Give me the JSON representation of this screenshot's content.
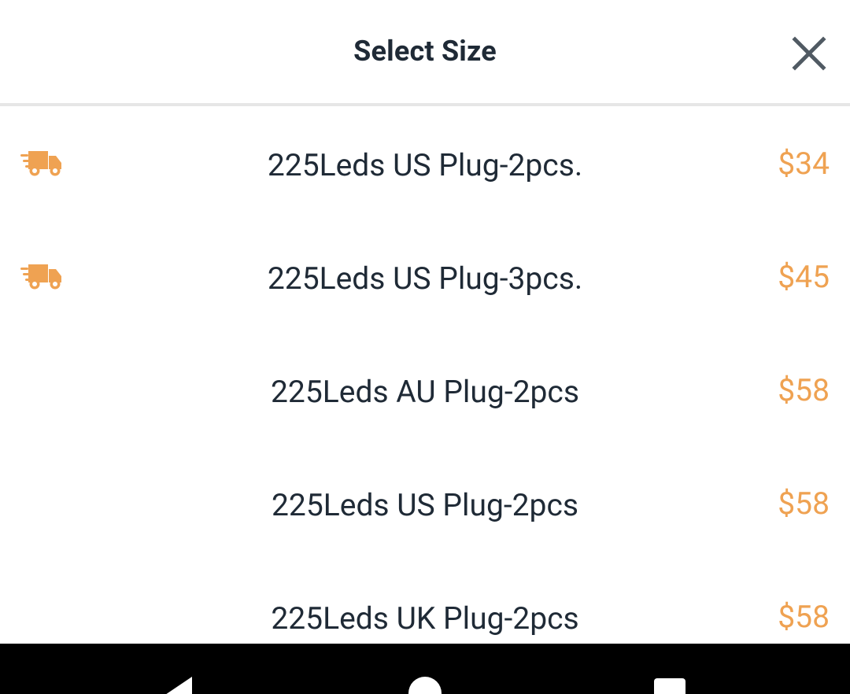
{
  "header": {
    "title": "Select Size",
    "close_icon": "close-icon"
  },
  "options": [
    {
      "label": "225Leds US Plug-2pcs.",
      "price": "$34",
      "fast_shipping": true
    },
    {
      "label": "225Leds US Plug-3pcs.",
      "price": "$45",
      "fast_shipping": true
    },
    {
      "label": "225Leds AU Plug-2pcs",
      "price": "$58",
      "fast_shipping": false
    },
    {
      "label": "225Leds US Plug-2pcs",
      "price": "$58",
      "fast_shipping": false
    },
    {
      "label": "225Leds UK Plug-2pcs",
      "price": "$58",
      "fast_shipping": false
    }
  ],
  "colors": {
    "title_text": "#1f2a36",
    "price": "#efa252",
    "shipping_icon": "#efa252",
    "divider": "#e6e6e6",
    "nav_bar": "#000000"
  },
  "icons": {
    "shipping": "fast-shipping-truck-icon",
    "nav_back": "back-triangle-icon",
    "nav_home": "home-circle-icon",
    "nav_recent": "recent-apps-square-icon"
  }
}
